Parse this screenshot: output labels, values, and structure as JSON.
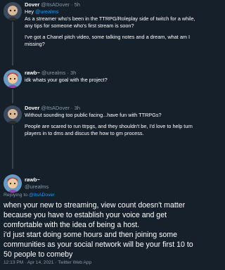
{
  "tweets": [
    {
      "name": "Dover",
      "handle": "@ItsADover",
      "time": "5h",
      "replying_prefix": "Hey ",
      "mention": "@urealms",
      "line1": "As a streamer who's been in the TTRPG/Roleplay side of twitch for a while, any tips for someone who's first stream is soon?",
      "line2": "I've got a Chanel pitch video, some talking notes and a dream, what am I missing?"
    },
    {
      "name": "rawb~",
      "handle": "@urealms",
      "time": "3h",
      "line1": "idk whats your goal with the project?"
    },
    {
      "name": "Dover",
      "handle": "@ItsADover",
      "time": "3h",
      "line1": "Without sounding too public facing...have fun with TTRPGs?",
      "line2": "People are scared to run ttrpgs, and they shouldn't be, I'd love to help turn players in to dms and discus the how to gm process."
    }
  ],
  "main_tweet": {
    "name": "rawb~",
    "handle": "@urealms",
    "replying_label": "Replying to ",
    "replying_to": "@ItsADover",
    "para1": "when your new to streaming, view count doesn't matter because you have to establish your voice and get comfortable with the idea of being a host.",
    "para2": "i'd just start doing some hours and then joining some communities as your social network will be your first 10 to 50 people to comeby",
    "footer": "12:13 PM · Apr 14, 2021 · Twitter Web App"
  },
  "sep": " · ",
  "colors": {
    "background": "#15202b",
    "link": "#1d9bf0",
    "muted": "#8899a6"
  }
}
